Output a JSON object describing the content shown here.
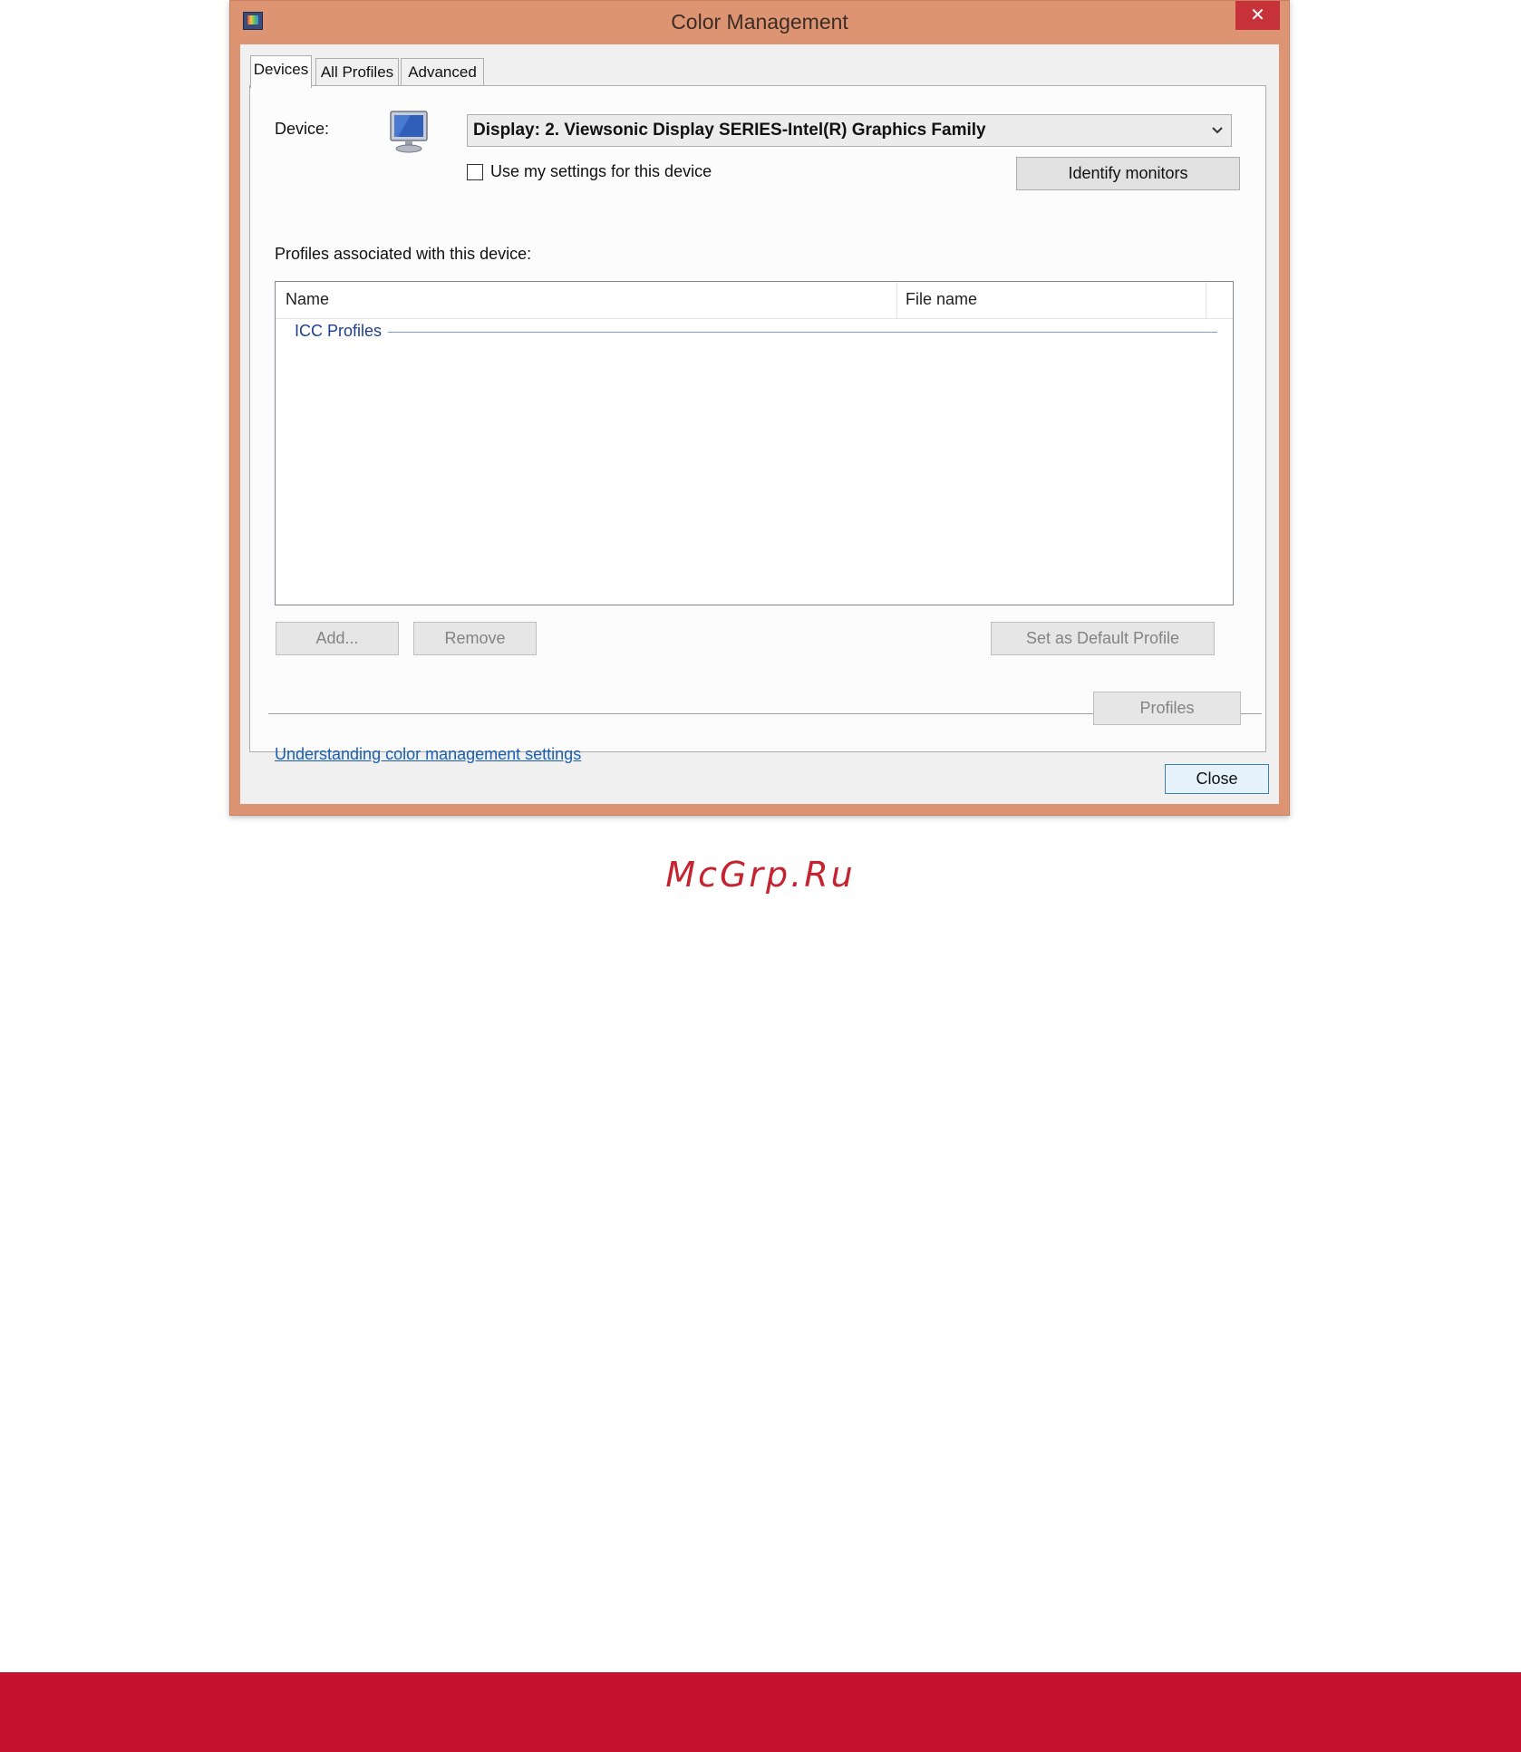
{
  "window": {
    "title": "Color Management",
    "close_glyph": "✕",
    "app_icon": "color-management-icon"
  },
  "tabs": [
    {
      "label": "Devices",
      "active": true
    },
    {
      "label": "All Profiles",
      "active": false
    },
    {
      "label": "Advanced",
      "active": false
    }
  ],
  "devices": {
    "device_label": "Device:",
    "device_icon": "monitor-icon",
    "device_value": "Display: 2. Viewsonic Display SERIES-Intel(R) Graphics Family",
    "use_settings_label": "Use my settings for this device",
    "use_settings_checked": false,
    "identify_button": "Identify monitors",
    "profiles_label": "Profiles associated with this device:",
    "columns": [
      "Name",
      "File name"
    ],
    "group_label": "ICC Profiles",
    "add_button": "Add...",
    "remove_button": "Remove",
    "set_default_button": "Set as Default Profile",
    "link_text": "Understanding color management settings",
    "profiles_button": "Profiles"
  },
  "footer": {
    "close_button": "Close"
  },
  "watermark": "McGrp.Ru",
  "colors": {
    "window_frame": "#dd9473",
    "close_red": "#c7313a",
    "link_blue": "#1b5fb4",
    "group_blue": "#1e3f8f",
    "footer_band": "#c4122f"
  }
}
